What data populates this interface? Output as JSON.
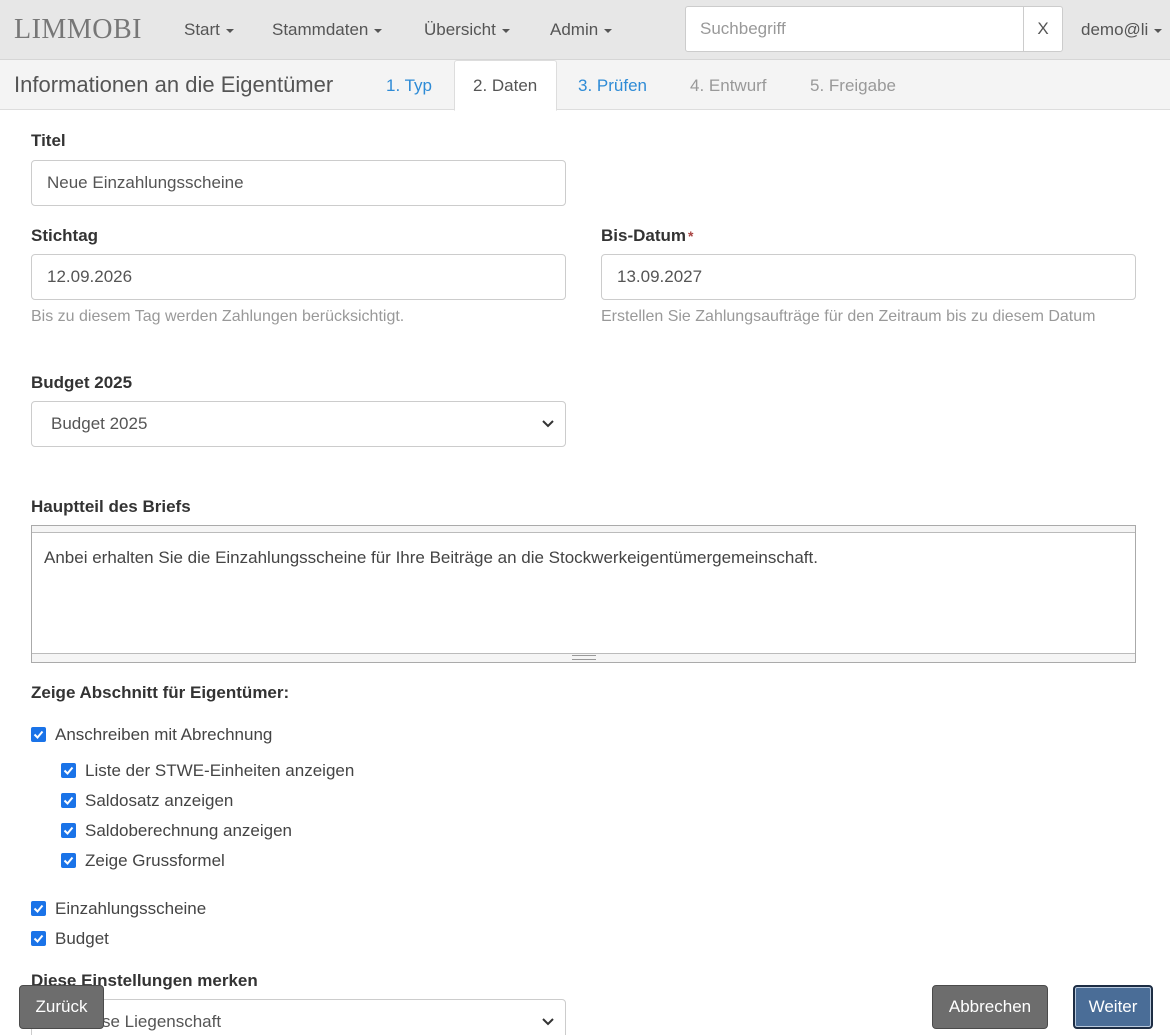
{
  "navbar": {
    "brand": "LIMMOBI",
    "menu": [
      "Start",
      "Stammdaten",
      "Übersicht",
      "Admin"
    ],
    "search_placeholder": "Suchbegriff",
    "search_clear": "X",
    "user": "demo@li"
  },
  "subheader": {
    "title": "Informationen an die Eigentümer",
    "tabs": [
      {
        "label": "1. Typ",
        "state": "link"
      },
      {
        "label": "2. Daten",
        "state": "active"
      },
      {
        "label": "3. Prüfen",
        "state": "link"
      },
      {
        "label": "4. Entwurf",
        "state": "disabled"
      },
      {
        "label": "5. Freigabe",
        "state": "disabled"
      }
    ]
  },
  "form": {
    "title_label": "Titel",
    "title_value": "Neue Einzahlungsscheine",
    "stichtag_label": "Stichtag",
    "stichtag_value": "12.09.2026",
    "stichtag_help": "Bis zu diesem Tag werden Zahlungen berücksichtigt.",
    "bisdatum_label": "Bis-Datum",
    "required_mark": "*",
    "bisdatum_value": "13.09.2027",
    "bisdatum_help": "Erstellen Sie Zahlungsaufträge für den Zeitraum bis zu diesem Datum",
    "budget_label": "Budget 2025",
    "budget_selected": "Budget 2025",
    "body_label": "Hauptteil des Briefs",
    "body_text": "Anbei erhalten Sie die Einzahlungsscheine für Ihre Beiträge an die Stockwerkeigentümergemeinschaft.",
    "sections_label": "Zeige Abschnitt für Eigentümer:",
    "checkboxes": [
      {
        "label": "Anschreiben mit Abrechnung",
        "checked": true
      },
      {
        "label": "Liste der STWE-Einheiten anzeigen",
        "checked": true
      },
      {
        "label": "Saldosatz anzeigen",
        "checked": true
      },
      {
        "label": "Saldoberechnung anzeigen",
        "checked": true
      },
      {
        "label": "Zeige Grussformel",
        "checked": true
      },
      {
        "label": "Einzahlungsscheine",
        "checked": true
      },
      {
        "label": "Budget",
        "checked": true
      }
    ],
    "remember_label": "Diese Einstellungen merken",
    "remember_selected_partial": "se Liegenschaft"
  },
  "buttons": {
    "back": "Zurück",
    "cancel": "Abbrechen",
    "next": "Weiter"
  },
  "colors": {
    "link": "#2e8bd6",
    "checkbox": "#1a73e8",
    "primary_button": "#4a6d97",
    "default_button": "#6d6d6d"
  }
}
